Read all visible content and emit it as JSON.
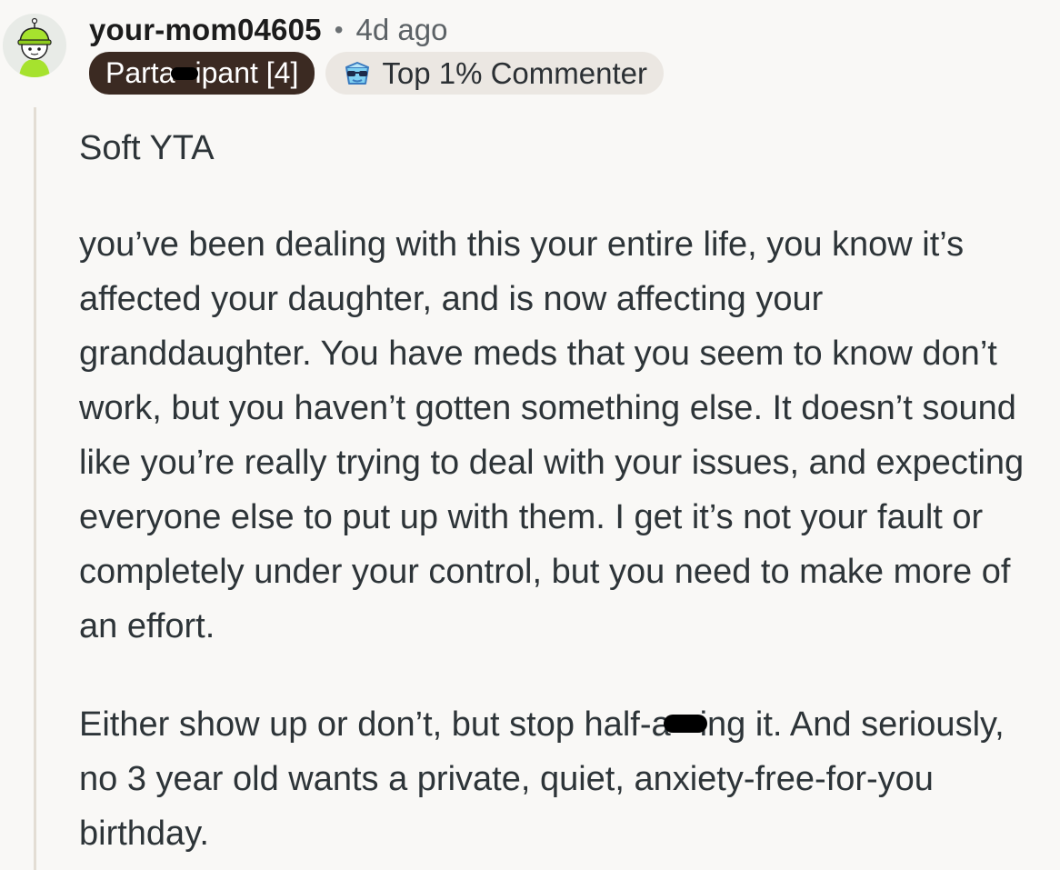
{
  "comment": {
    "username": "your-mom04605",
    "separator": "•",
    "age": "4d ago",
    "flair": {
      "before_redaction": "Parta",
      "after_redaction": "ipant [4]",
      "color": "#3b2a22"
    },
    "achievement": {
      "icon": "sunglasses-badge-icon",
      "label": "Top 1% Commenter"
    },
    "paragraphs": [
      "Soft YTA",
      "you’ve been dealing with this your entire life, you know it’s affected your daughter, and is now affecting your granddaughter. You have meds that you seem to know don’t work, but you haven’t gotten something else. It doesn’t sound like you’re really trying to deal with your issues, and expecting everyone else to put up with them. I get it’s not your fault or completely under your control, but you need to make more of an effort."
    ],
    "last_paragraph": {
      "before_redaction": "Either show up or don’t, but stop half-a",
      "after_redaction": "ing it. And seriously, no 3 year old wants a private, quiet, anxiety-free-for-you birthday."
    }
  }
}
